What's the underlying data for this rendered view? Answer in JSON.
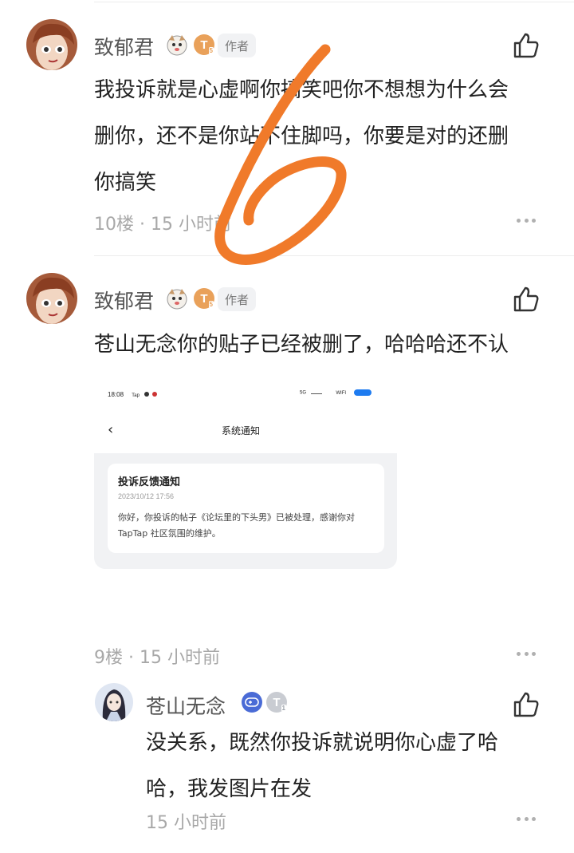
{
  "comments": [
    {
      "username": "致郁君",
      "author_tag": "作者",
      "level": "T",
      "level_sub": "5",
      "lines": [
        "我投诉就是心虚啊你搞笑吧你不想想为什么会",
        "删你，还不是你站不住脚吗，你要是对的还删",
        "你搞笑"
      ],
      "meta": "10楼 · 15 小时前"
    },
    {
      "username": "致郁君",
      "author_tag": "作者",
      "level": "T",
      "level_sub": "5",
      "lines": [
        "苍山无念你的贴子已经被删了，哈哈哈还不认"
      ],
      "meta": "9楼 · 15 小时前"
    }
  ],
  "reply": {
    "username": "苍山无念",
    "level": "T",
    "level_sub": "1",
    "lines": [
      "没关系，既然你投诉就说明你心虚了哈",
      "哈，我发图片在发"
    ],
    "meta": "15 小时前"
  },
  "screenshot": {
    "time": "18:08",
    "app_label": "Tap",
    "net_5g": "5G",
    "wifi": "WIFI",
    "page_title": "系统通知",
    "notice_title": "投诉反馈通知",
    "notice_date": "2023/10/12 17:56",
    "notice_body": "你好，你投诉的帖子《论坛里的下头男》已被处理，感谢你对 TapTap 社区氛围的维护。"
  },
  "overlay": {
    "scribble_text": "6",
    "scribble_color": "#f07a2a"
  },
  "colors": {
    "meta": "#a8a8a8",
    "badge_gold": "#e9a15a",
    "badge_gray": "#c9ccd2"
  }
}
